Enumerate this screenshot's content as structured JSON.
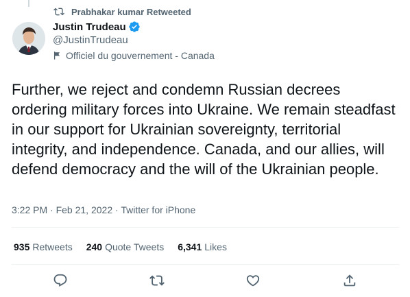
{
  "retweet_banner": {
    "text": "Prabhakar kumar Retweeted",
    "icon": "retweet-icon"
  },
  "author": {
    "name": "Justin Trudeau",
    "handle": "@JustinTrudeau",
    "verified": true,
    "label": "Officiel du gouvernement - Canada"
  },
  "tweet": {
    "text": "Further, we reject and condemn Russian decrees ordering military forces into Ukraine. We remain steadfast in our support for Ukrainian sovereignty, territorial integrity, and independence. Canada, and our allies, will defend democracy and the will of the Ukrainian people.",
    "time": "3:22 PM",
    "date": "Feb 21, 2022",
    "source": "Twitter for iPhone"
  },
  "stats": {
    "retweets_count": "935",
    "retweets_label": "Retweets",
    "quotes_count": "240",
    "quotes_label": "Quote Tweets",
    "likes_count": "6,341",
    "likes_label": "Likes"
  },
  "actions": [
    "reply-icon",
    "retweet-icon",
    "like-icon",
    "share-icon"
  ],
  "colors": {
    "text": "#0f1419",
    "secondary": "#536471",
    "verified": "#1d9bf0",
    "divider": "#eff3f4"
  }
}
